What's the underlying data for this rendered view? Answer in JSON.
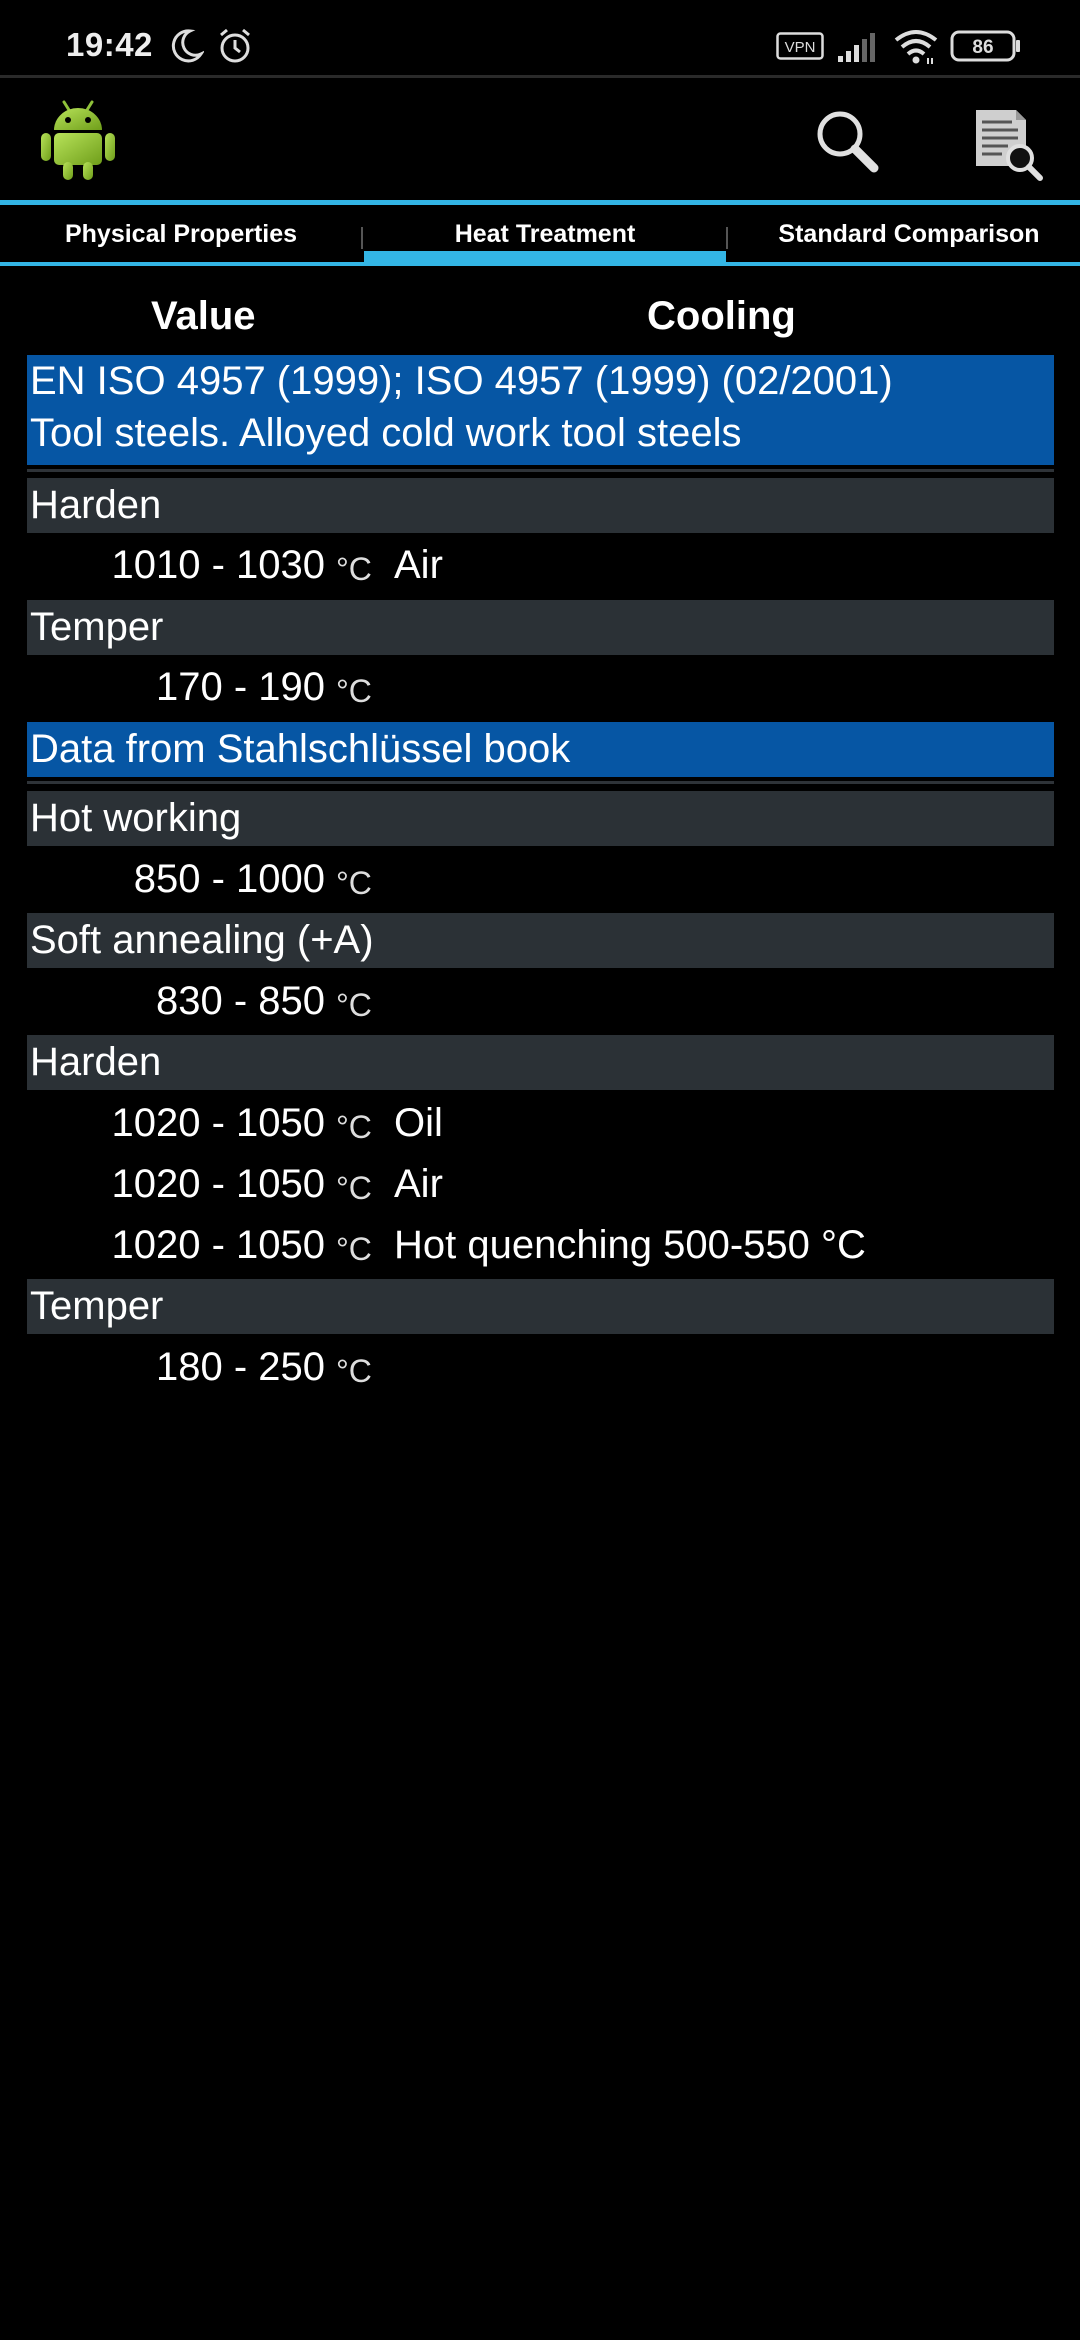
{
  "status_bar": {
    "time": "19:42",
    "vpn_label": "VPN",
    "battery_level": "86",
    "icons": [
      "moon-icon",
      "alarm-icon",
      "vpn-icon",
      "signal-icon",
      "wifi-icon",
      "battery-icon"
    ]
  },
  "action_bar": {
    "icons": [
      "android-logo-icon",
      "search-icon",
      "document-search-icon"
    ]
  },
  "tabs": [
    {
      "label": "Physical Properties",
      "selected": false
    },
    {
      "label": "Heat Treatment",
      "selected": true
    },
    {
      "label": "Standard Comparison",
      "selected": false
    }
  ],
  "columns": {
    "value": "Value",
    "cooling": "Cooling"
  },
  "banner1": {
    "line1": "EN ISO 4957 (1999); ISO 4957 (1999) (02/2001)",
    "line2": "Tool steels. Alloyed cold work tool steels"
  },
  "banner2": {
    "line1": "Data from Stahlschlüssel book"
  },
  "sections": [
    {
      "label": "Harden",
      "rows": [
        {
          "value": "1010 - 1030",
          "unit": "°C",
          "cooling": "Air"
        }
      ]
    },
    {
      "label": "Temper",
      "rows": [
        {
          "value": "170 - 190",
          "unit": "°C",
          "cooling": ""
        }
      ]
    },
    {
      "label": "Hot working",
      "rows": [
        {
          "value": "850 - 1000",
          "unit": "°C",
          "cooling": ""
        }
      ]
    },
    {
      "label": "Soft annealing (+A)",
      "rows": [
        {
          "value": "830 - 850",
          "unit": "°C",
          "cooling": ""
        }
      ]
    },
    {
      "label": "Harden",
      "rows": [
        {
          "value": "1020 - 1050",
          "unit": "°C",
          "cooling": "Oil"
        },
        {
          "value": "1020 - 1050",
          "unit": "°C",
          "cooling": "Air"
        },
        {
          "value": "1020 - 1050",
          "unit": "°C",
          "cooling": "Hot quenching 500-550 °C"
        }
      ]
    },
    {
      "label": "Temper",
      "rows": [
        {
          "value": "180 - 250",
          "unit": "°C",
          "cooling": ""
        }
      ]
    }
  ],
  "colors": {
    "accent": "#33b5e5",
    "banner": "#0656a4",
    "section_header": "#2b3136",
    "background": "#000000"
  }
}
